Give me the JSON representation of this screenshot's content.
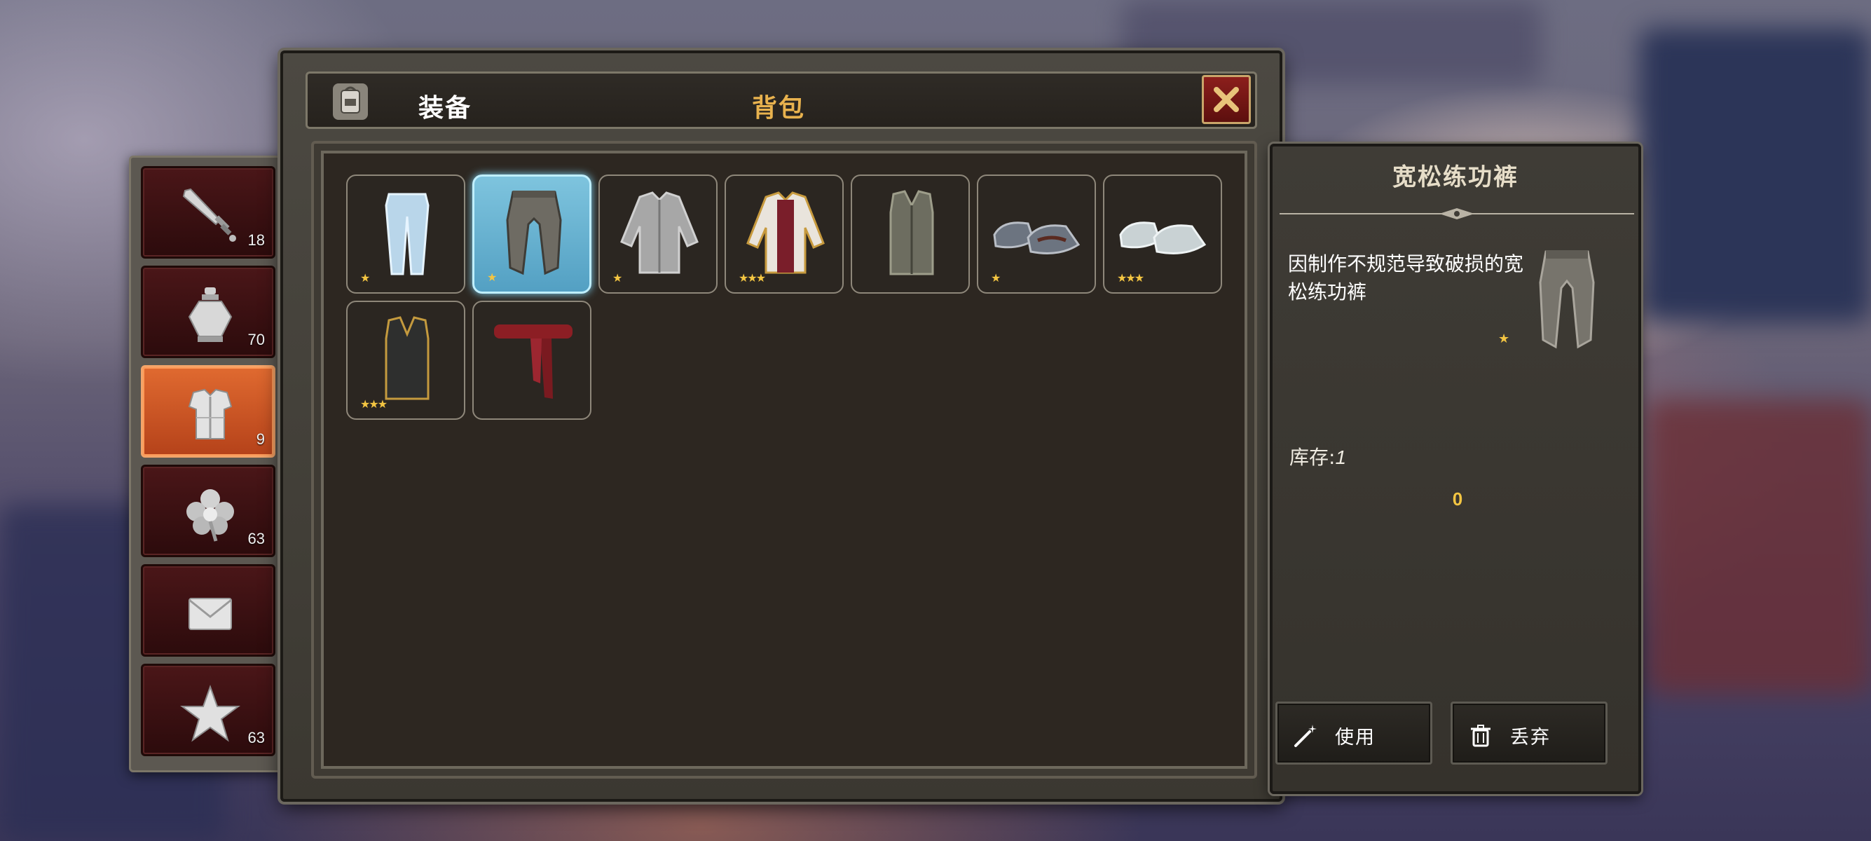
{
  "header": {
    "title": "装备",
    "active_tab": "背包"
  },
  "categories": [
    {
      "icon": "sword-icon",
      "count": "18",
      "active": false
    },
    {
      "icon": "potion-icon",
      "count": "70",
      "active": false
    },
    {
      "icon": "armor-icon",
      "count": "9",
      "active": true
    },
    {
      "icon": "herb-icon",
      "count": "63",
      "active": false
    },
    {
      "icon": "letter-icon",
      "count": "",
      "active": false
    },
    {
      "icon": "star-icon",
      "count": "63",
      "active": false
    }
  ],
  "inventory": [
    {
      "icon": "trousers-icon",
      "stars": "★",
      "selected": false
    },
    {
      "icon": "loose-pants-icon",
      "stars": "★",
      "selected": true
    },
    {
      "icon": "padded-jacket-icon",
      "stars": "★",
      "selected": false
    },
    {
      "icon": "red-jacket-icon",
      "stars": "★★★",
      "selected": false
    },
    {
      "icon": "vest-icon",
      "stars": "",
      "selected": false
    },
    {
      "icon": "cloth-shoes-icon",
      "stars": "★",
      "selected": false
    },
    {
      "icon": "white-shoes-icon",
      "stars": "★★★",
      "selected": false
    },
    {
      "icon": "black-vest-icon",
      "stars": "★★★",
      "selected": false
    },
    {
      "icon": "red-sash-icon",
      "stars": "",
      "selected": false
    }
  ],
  "detail": {
    "name": "宽松练功裤",
    "description": "因制作不规范导致破损的宽松练功裤",
    "stars": "★",
    "stock_label": "库存:",
    "stock_value": "1",
    "price": "0",
    "use_label": "使用",
    "discard_label": "丢弃"
  },
  "colors": {
    "gold_text": "#e8b24e",
    "active_tab": "#d45a26",
    "selected_slot": "#6fb8d8",
    "star": "#f3c542"
  }
}
